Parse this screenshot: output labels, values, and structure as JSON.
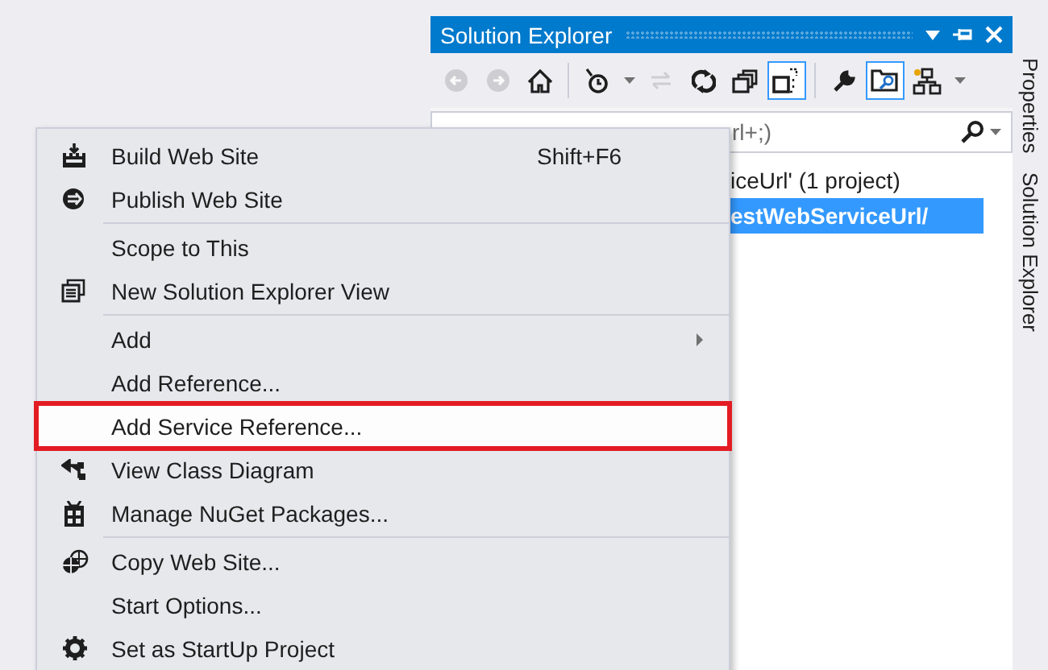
{
  "solution_explorer": {
    "title": "Solution Explorer",
    "toolbar": [
      {
        "kind": "back",
        "disabled": true,
        "pressed": false
      },
      {
        "kind": "forward",
        "disabled": true,
        "pressed": false
      },
      {
        "kind": "home",
        "disabled": false,
        "pressed": false
      },
      {
        "kind": "separator"
      },
      {
        "kind": "history",
        "disabled": false,
        "pressed": false
      },
      {
        "kind": "caret",
        "disabled": false,
        "pressed": false
      },
      {
        "kind": "sync",
        "disabled": true,
        "pressed": false
      },
      {
        "kind": "refresh",
        "disabled": false,
        "pressed": false
      },
      {
        "kind": "collapse",
        "disabled": false,
        "pressed": false
      },
      {
        "kind": "showall",
        "disabled": false,
        "pressed": true
      },
      {
        "kind": "separator"
      },
      {
        "kind": "wrench",
        "disabled": false,
        "pressed": false
      },
      {
        "kind": "preview",
        "disabled": false,
        "pressed": true
      },
      {
        "kind": "classview",
        "disabled": false,
        "pressed": false
      },
      {
        "kind": "caret",
        "disabled": false,
        "pressed": false
      }
    ],
    "search": {
      "value": "rl+;)"
    },
    "tree": [
      {
        "label": "iceUrl' (1 project)",
        "selected": false
      },
      {
        "label": "estWebServiceUrl/",
        "selected": true
      }
    ]
  },
  "side_tabs": [
    "Properties",
    "Solution Explorer"
  ],
  "context_menu": {
    "groups": [
      [
        {
          "label": "Build Web Site",
          "shortcut": "Shift+F6",
          "submenu": false,
          "selected": false,
          "highlighted": false
        },
        {
          "label": "Publish Web Site",
          "submenu": false,
          "selected": false,
          "highlighted": false
        }
      ],
      [
        {
          "label": "Scope to This",
          "submenu": false,
          "selected": false,
          "highlighted": false
        },
        {
          "label": "New Solution Explorer View",
          "submenu": false,
          "selected": false,
          "highlighted": false
        }
      ],
      [
        {
          "label": "Add",
          "submenu": true,
          "selected": false,
          "highlighted": false
        },
        {
          "label": "Add Reference...",
          "submenu": false,
          "selected": false,
          "highlighted": false
        },
        {
          "label": "Add Service Reference...",
          "submenu": false,
          "selected": true,
          "highlighted": true
        },
        {
          "label": "View Class Diagram",
          "submenu": false,
          "selected": false,
          "highlighted": false
        },
        {
          "label": "Manage NuGet Packages...",
          "submenu": false,
          "selected": false,
          "highlighted": false
        }
      ],
      [
        {
          "label": "Copy Web Site...",
          "submenu": false,
          "selected": false,
          "highlighted": false
        },
        {
          "label": "Start Options...",
          "submenu": false,
          "selected": false,
          "highlighted": false
        },
        {
          "label": "Set as StartUp Project",
          "submenu": false,
          "selected": false,
          "highlighted": false
        }
      ]
    ]
  }
}
